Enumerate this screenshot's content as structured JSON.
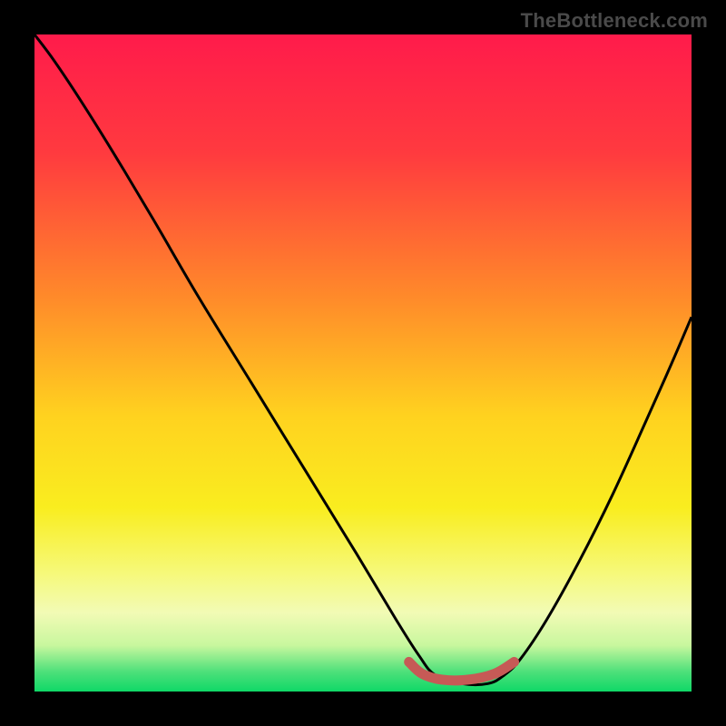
{
  "watermark": "TheBottleneck.com",
  "chart_data": {
    "type": "line",
    "title": "",
    "xlabel": "",
    "ylabel": "",
    "xlim": [
      0,
      100
    ],
    "ylim": [
      0,
      100
    ],
    "gradient_stops": [
      {
        "offset": 0.0,
        "color": "#ff1b4b"
      },
      {
        "offset": 0.18,
        "color": "#ff3a3f"
      },
      {
        "offset": 0.4,
        "color": "#ff8a2a"
      },
      {
        "offset": 0.58,
        "color": "#ffd21f"
      },
      {
        "offset": 0.72,
        "color": "#f9ed1f"
      },
      {
        "offset": 0.82,
        "color": "#f6f97a"
      },
      {
        "offset": 0.88,
        "color": "#f2fbb5"
      },
      {
        "offset": 0.93,
        "color": "#c8f79e"
      },
      {
        "offset": 0.97,
        "color": "#4de07a"
      },
      {
        "offset": 1.0,
        "color": "#0fd867"
      }
    ],
    "series": [
      {
        "name": "bottleneck-curve",
        "color": "#000000",
        "x": [
          0.0,
          3.0,
          7.0,
          12.0,
          18.0,
          25.0,
          33.0,
          41.0,
          49.0,
          55.0,
          58.5,
          61.0,
          65.0,
          69.0,
          71.5,
          74.0,
          78.0,
          83.0,
          88.0,
          93.0,
          97.0,
          100.0
        ],
        "y": [
          100.0,
          96.0,
          90.0,
          82.0,
          72.0,
          60.0,
          47.0,
          34.0,
          21.0,
          11.0,
          5.5,
          2.5,
          1.2,
          1.2,
          2.5,
          5.0,
          11.0,
          20.0,
          30.0,
          41.0,
          50.0,
          57.0
        ]
      },
      {
        "name": "sweet-spot-band",
        "color": "#c65a56",
        "x": [
          57.0,
          59.0,
          62.0,
          66.0,
          70.0,
          73.0
        ],
        "y": [
          4.5,
          2.7,
          1.8,
          1.8,
          2.7,
          4.5
        ]
      }
    ]
  }
}
